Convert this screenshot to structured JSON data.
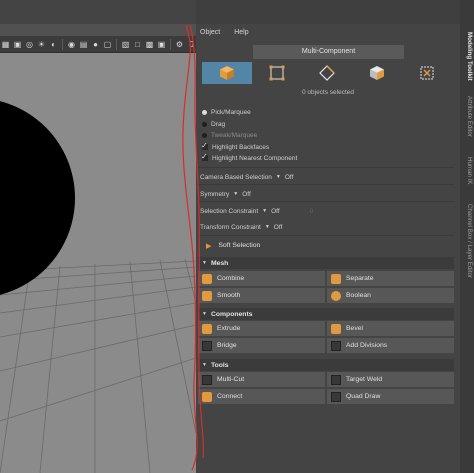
{
  "menu": {
    "object": "Object",
    "help": "Help"
  },
  "mode": {
    "title": "Multi-Component",
    "buttons": [
      {
        "name": "object-mode",
        "icon": "cube-solid-icon",
        "active": true
      },
      {
        "name": "vertex-mode",
        "icon": "vertex-square-icon",
        "active": false
      },
      {
        "name": "edge-mode",
        "icon": "edge-diamond-icon",
        "active": false
      },
      {
        "name": "face-mode",
        "icon": "face-cube-icon",
        "active": false
      },
      {
        "name": "uv-mode",
        "icon": "uv-icon",
        "active": false
      }
    ],
    "selected_count": "0 objects selected"
  },
  "selection": {
    "pick_marquee": "Pick/Marquee",
    "drag": "Drag",
    "tweak_marquee": "Tweak/Marquee",
    "highlight_backfaces": "Highlight Backfaces",
    "highlight_nearest": "Highlight Nearest Component"
  },
  "options": {
    "camera_based": {
      "label": "Camera Based Selection",
      "value": "Off"
    },
    "symmetry": {
      "label": "Symmetry",
      "value": "Off"
    },
    "selection_constraint": {
      "label": "Selection Constraint",
      "value": "Off",
      "extra": "0"
    },
    "transform_constraint": {
      "label": "Transform Constraint",
      "value": "Off"
    }
  },
  "soft_selection": "Soft Selection",
  "sections": {
    "mesh": "Mesh",
    "components": "Components",
    "tools": "Tools"
  },
  "tools": {
    "combine": "Combine",
    "separate": "Separate",
    "smooth": "Smooth",
    "boolean": "Boolean",
    "extrude": "Extrude",
    "bevel": "Bevel",
    "bridge": "Bridge",
    "add_divisions": "Add Divisions",
    "multi_cut": "Multi-Cut",
    "target_weld": "Target Weld",
    "connect": "Connect",
    "quad_draw": "Quad Draw"
  },
  "side_tabs": [
    "Modeling Toolkit",
    "Attribute Editor",
    "Human IK",
    "Channel Box / Layer Editor"
  ],
  "colors": {
    "accent": "#5285a6",
    "orange": "#e19a3d",
    "annotation": "#d4302a"
  }
}
